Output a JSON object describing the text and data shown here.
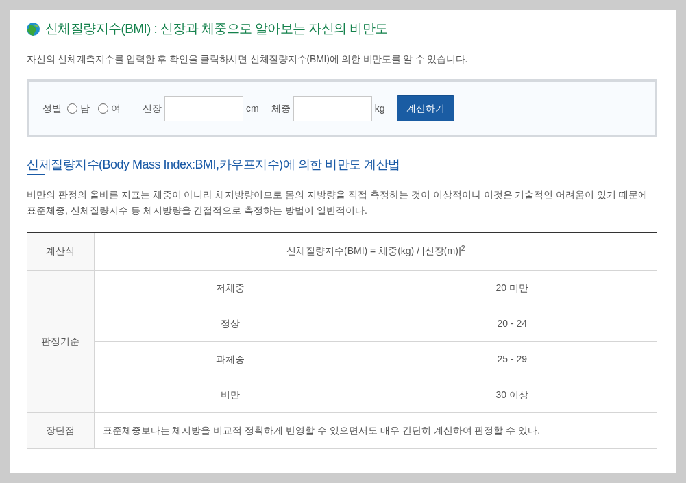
{
  "title": "신체질량지수(BMI) : 신장과 체중으로 알아보는 자신의 비만도",
  "intro": "자신의 신체계측지수를 입력한 후 확인을 클릭하시면 신체질량지수(BMI)에 의한 비만도를 알 수 있습니다.",
  "form": {
    "gender_label": "성별",
    "gender_options": [
      {
        "label": "남",
        "selected": false
      },
      {
        "label": "여",
        "selected": false
      }
    ],
    "fields": [
      {
        "label": "신장",
        "unit": "cm"
      },
      {
        "label": "체중",
        "unit": "kg"
      }
    ],
    "button": "계산하기"
  },
  "section": {
    "heading": "신체질량지수(Body Mass Index:BMI,카우프지수)에 의한 비만도 계산법",
    "paragraph": "비만의 판정의 올바른 지표는 체중이 아니라 체지방량이므로 몸의 지방량을 직접 측정하는 것이 이상적이나 이것은 기술적인 어려움이 있기 때문에 표준체중, 신체질량지수 등 체지방량을 간접적으로 측정하는 방법이 일반적이다."
  },
  "table": {
    "formula_row": {
      "header": "계산식",
      "formula": "신체질량지수(BMI) = 체중(kg) / [신장(m)]$^{2}$"
    },
    "criteria": {
      "header": "판정기준",
      "rows": [
        {
          "category": "저체중",
          "range": "20 미만"
        },
        {
          "category": "정상",
          "range": "20 - 24"
        },
        {
          "category": "과체중",
          "range": "25 - 29"
        },
        {
          "category": "비만",
          "range": "30 이상"
        }
      ]
    },
    "pros_cons": {
      "header": "장단점",
      "text": "표준체중보다는 체지방을 비교적 정확하게 반영할 수 있으면서도 매우 간단히 계산하여 판정할 수 있다."
    }
  }
}
